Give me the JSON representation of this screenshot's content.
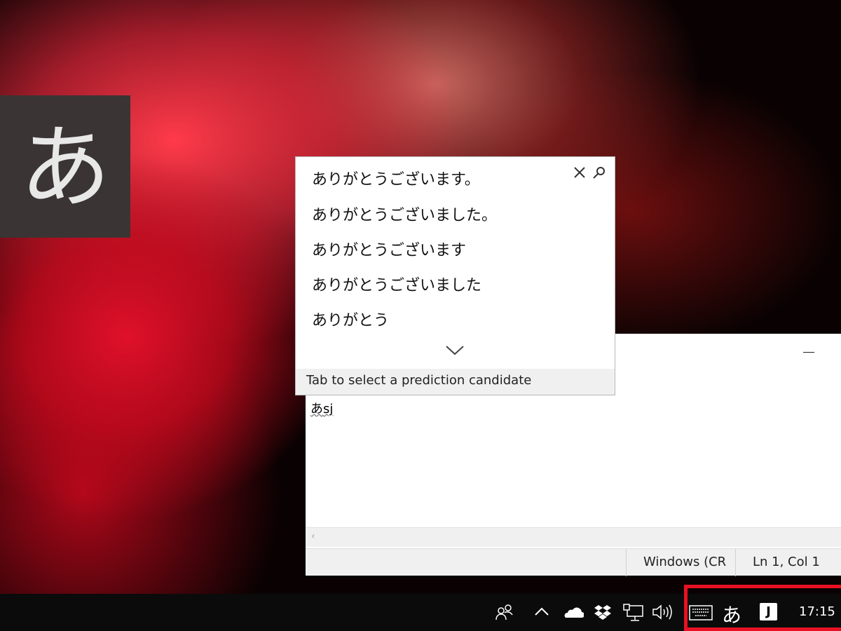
{
  "ime_mode_indicator": "あ",
  "prediction_popup": {
    "candidates": [
      "ありがとうございます。",
      "ありがとうございました。",
      "ありがとうございます",
      "ありがとうございました",
      "ありがとう"
    ],
    "close_icon": "close-icon",
    "search_icon": "search-icon",
    "expand_icon": "chevron-down-icon",
    "footer": "Tab to select a prediction candidate"
  },
  "notepad": {
    "text_composed": "あ",
    "text_pending": "sj",
    "minimize_label": "–",
    "status": {
      "encoding": "Windows (CR",
      "position": "Ln 1, Col 1"
    }
  },
  "taskbar": {
    "icons": [
      "people-icon",
      "show-hidden-icons-chevron",
      "onedrive-icon",
      "dropbox-icon",
      "network-icon",
      "volume-icon",
      "touch-keyboard-icon"
    ],
    "ime_mode": "あ",
    "ime_app": "J",
    "clock": "17:15",
    "highlight_color": "#e81123"
  }
}
